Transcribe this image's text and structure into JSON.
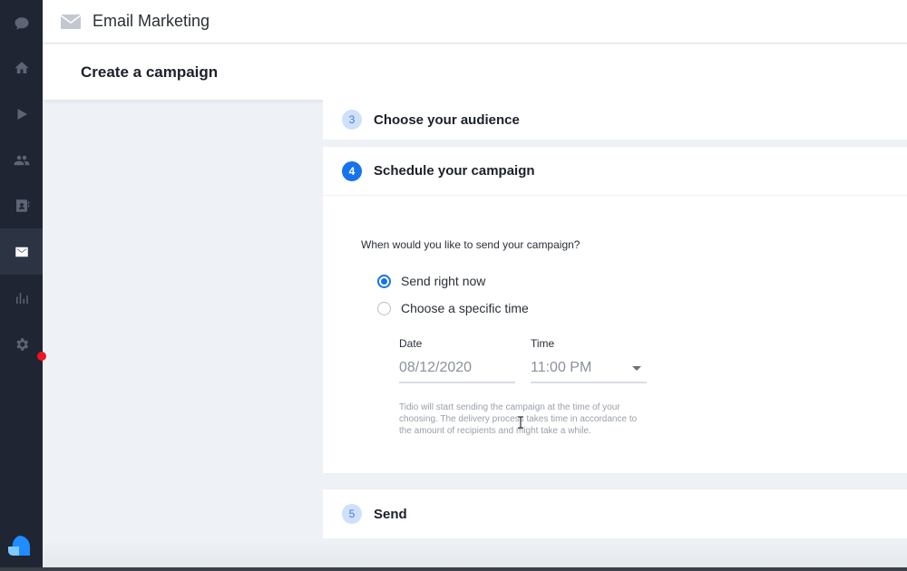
{
  "app": {
    "title": "Email Marketing",
    "page_title": "Create a campaign"
  },
  "sidebar": {
    "items": [
      {
        "icon": "chat-icon",
        "active": false
      },
      {
        "icon": "home-icon",
        "active": false
      },
      {
        "icon": "play-icon",
        "active": false
      },
      {
        "icon": "people-icon",
        "active": false
      },
      {
        "icon": "contacts-icon",
        "active": false
      },
      {
        "icon": "mail-icon",
        "active": true
      },
      {
        "icon": "analytics-icon",
        "active": false
      },
      {
        "icon": "gear-icon",
        "active": false
      }
    ]
  },
  "steps": {
    "audience": {
      "number": "3",
      "title": "Choose your audience"
    },
    "schedule": {
      "number": "4",
      "title": "Schedule your campaign"
    },
    "send": {
      "number": "5",
      "title": "Send"
    }
  },
  "schedule": {
    "question": "When would you like to send your campaign?",
    "options": [
      {
        "label": "Send right now",
        "checked": true
      },
      {
        "label": "Choose a specific time",
        "checked": false
      }
    ],
    "date_label": "Date",
    "date_value": "08/12/2020",
    "time_label": "Time",
    "time_value": "11:00 PM",
    "help_text": "Tidio will start sending the campaign at the time of your choosing. The delivery process takes time in accordance to the amount of recipients and might take a while."
  },
  "colors": {
    "accent": "#1673ec",
    "sidebar_bg": "#1f2532",
    "notification": "#f0141e"
  }
}
